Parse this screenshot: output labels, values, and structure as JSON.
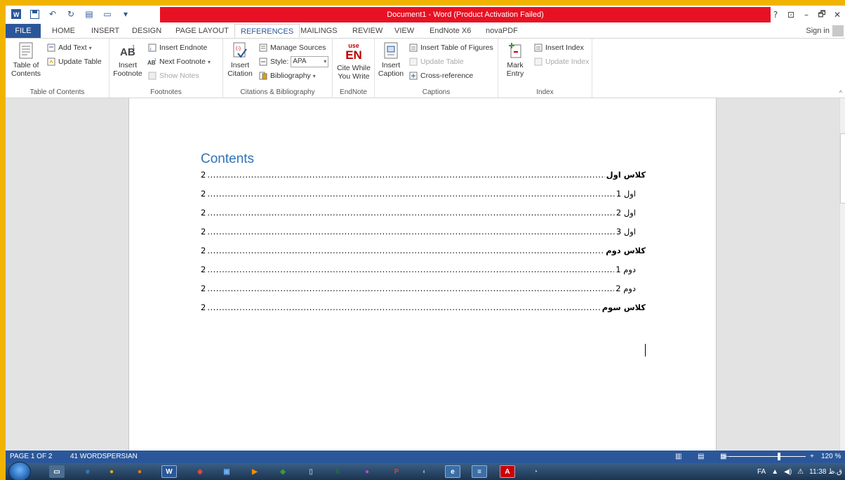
{
  "titlebar": {
    "title": "Document1 - Word (Product Activation Failed)",
    "help": "?",
    "controls": [
      "⊡",
      "–",
      "🗗",
      "✕"
    ]
  },
  "tabs": {
    "file": "FILE",
    "items": [
      "HOME",
      "INSERT",
      "DESIGN",
      "PAGE LAYOUT",
      "REFERENCES",
      "MAILINGS",
      "REVIEW",
      "VIEW",
      "EndNote X6",
      "novaPDF"
    ],
    "active": "REFERENCES",
    "sign_in": "Sign in"
  },
  "ribbon": {
    "toc_group": {
      "label": "Table of Contents",
      "toc_button": "Table of Contents",
      "add_text": "Add Text",
      "update_table": "Update Table"
    },
    "footnotes_group": {
      "label": "Footnotes",
      "insert_footnote": "Insert Footnote",
      "insert_endnote": "Insert Endnote",
      "next_footnote": "Next Footnote",
      "show_notes": "Show Notes"
    },
    "citations_group": {
      "label": "Citations & Bibliography",
      "insert_citation": "Insert Citation",
      "manage_sources": "Manage Sources",
      "style_label": "Style:",
      "style_value": "APA",
      "bibliography": "Bibliography"
    },
    "endnote_group": {
      "label": "EndNote",
      "cite_while": "Cite While You Write",
      "logo_top": "use",
      "logo_main": "EN"
    },
    "captions_group": {
      "label": "Captions",
      "insert_caption": "Insert Caption",
      "insert_tof": "Insert Table of Figures",
      "update_table": "Update Table",
      "cross_reference": "Cross-reference"
    },
    "index_group": {
      "label": "Index",
      "mark_entry": "Mark Entry",
      "insert_index": "Insert Index",
      "update_index": "Update Index"
    }
  },
  "document": {
    "toc_title": "Contents",
    "entries": [
      {
        "text": "کلاس اول",
        "page": "2",
        "level": 1
      },
      {
        "text": "اول 1",
        "page": "2",
        "level": 2
      },
      {
        "text": "اول 2",
        "page": "2",
        "level": 2
      },
      {
        "text": "اول 3",
        "page": "2",
        "level": 2
      },
      {
        "text": "کلاس دوم",
        "page": "2",
        "level": 1
      },
      {
        "text": "دوم 1",
        "page": "2",
        "level": 2
      },
      {
        "text": "دوم 2",
        "page": "2",
        "level": 2
      },
      {
        "text": "کلاس سوم",
        "page": "2",
        "level": 1
      }
    ]
  },
  "statusbar": {
    "page": "PAGE 1 OF 2",
    "words": "41 WORDS",
    "language": "PERSIAN",
    "zoom": "120 %"
  },
  "taskbar": {
    "lang": "FA",
    "time": "11:38 ق.ظ"
  },
  "colors": {
    "accent": "#2b579a",
    "title_alert": "#e81123",
    "heading": "#2e74b5",
    "frame": "#f0b400"
  }
}
